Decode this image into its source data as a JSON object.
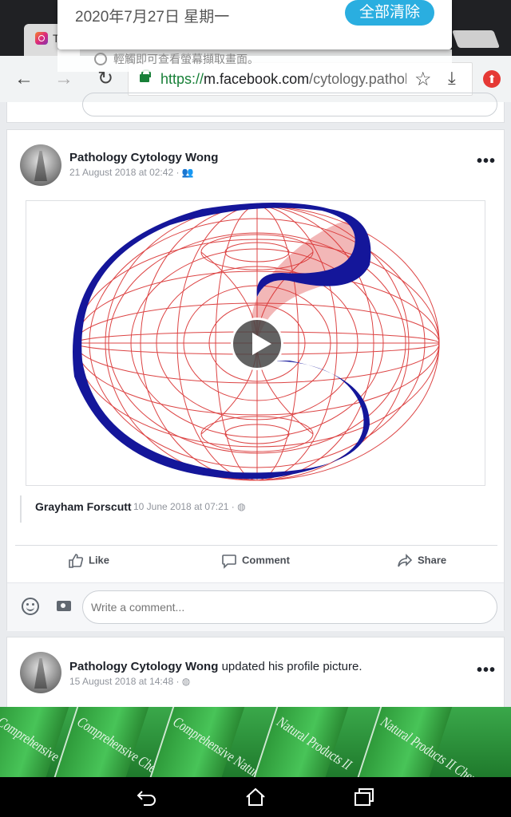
{
  "notification": {
    "date": "2020年7月27日 星期一",
    "clear_label": "全部清除",
    "subtitle": "輕觸即可查看螢幕擷取畫面。"
  },
  "tab": {
    "title": "T"
  },
  "toolbar": {
    "url_scheme": "https://",
    "url_host": "m.facebook.com",
    "url_path": "/cytology.patholo"
  },
  "post1": {
    "author": "Pathology Cytology Wong",
    "timestamp": "21 August 2018 at 02:42",
    "audience_icon": "friends-icon",
    "shared_author": "Grayham Forscutt",
    "shared_timestamp": "10 June 2018 at 07:21",
    "shared_audience_icon": "globe-icon",
    "actions": {
      "like": "Like",
      "comment": "Comment",
      "share": "Share"
    },
    "comment_placeholder": "Write a comment..."
  },
  "post2": {
    "author": "Pathology Cytology Wong",
    "action_text": "updated his profile picture.",
    "timestamp": "15 August 2018 at 14:48",
    "audience_icon": "globe-icon"
  },
  "photo": {
    "book_titles": [
      "Comprehensive Chemistry",
      "Comprehensive Chemistry and",
      "Comprehensive Natural Products",
      "Natural Products II",
      "Natural Products II Chemistry"
    ]
  },
  "colors": {
    "facebook_bg": "#e9ebee",
    "accent_blue": "#2aaee0",
    "torus_red": "#d93030",
    "torus_blue": "#14169a"
  }
}
